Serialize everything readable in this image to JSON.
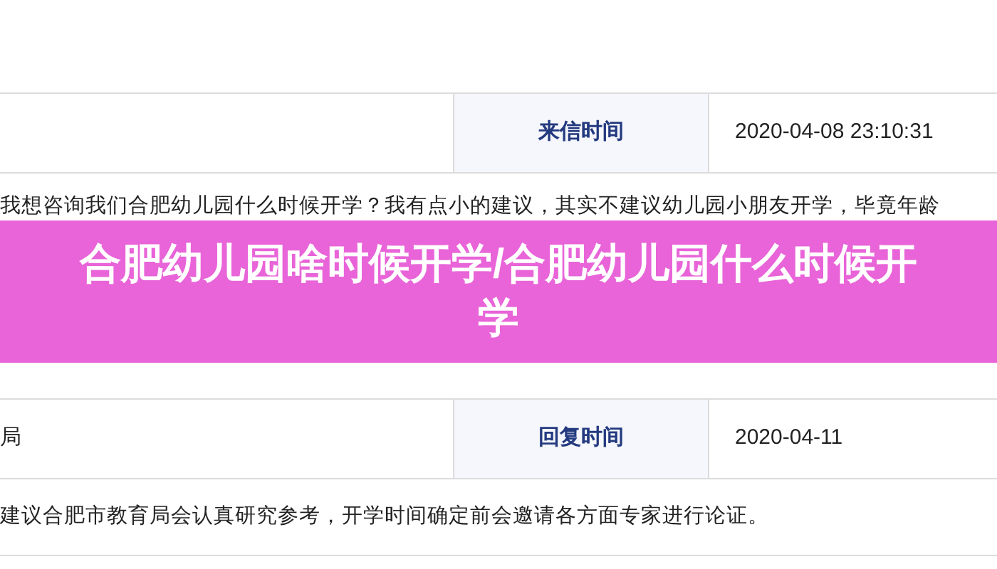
{
  "letter_row": {
    "label": "来信时间",
    "value": "2020-04-08 23:10:31"
  },
  "letter_text": "我想咨询我们合肥幼儿园什么时候开学？我有点小的建议，其实不建议幼儿园小朋友开学，毕竟年龄",
  "banner": {
    "title": "合肥幼儿园啥时候开学/合肥幼儿园什么时候开学"
  },
  "reply_row": {
    "cell_1": "局",
    "label": "回复时间",
    "value": "2020-04-11"
  },
  "reply_text": "建议合肥市教育局会认真研究参考，开学时间确定前会邀请各方面专家进行论证。"
}
